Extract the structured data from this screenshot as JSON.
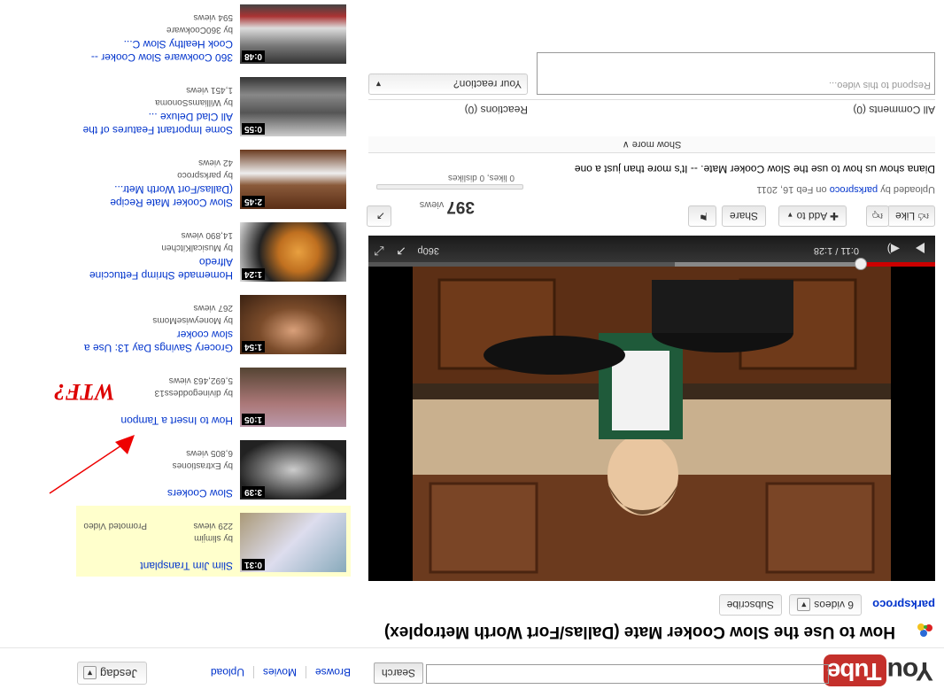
{
  "header": {
    "logo_you": "You",
    "logo_tube": "Tube",
    "search_value": "",
    "search_button": "Search",
    "nav": [
      "Browse",
      "Movies",
      "Upload"
    ],
    "user": "Jesdag"
  },
  "video": {
    "title": "How to Use the Slow Cooker Mate (Dallas/Fort Worth Metroplex)",
    "channel": "parksproco",
    "videos_count": "6 videos",
    "subscribe": "Subscribe",
    "time": "0:11 / 1:28",
    "quality": "360p",
    "progress_fraction": 0.13,
    "buffered_fraction": 0.46
  },
  "actions": {
    "like": "Like",
    "add_to": "Add to",
    "share": "Share",
    "views_count": "397",
    "views_label": "views",
    "likes_stats": "0 likes, 0 dislikes"
  },
  "info": {
    "uploaded_prefix": "Uploaded by",
    "uploader": "parksproco",
    "uploaded_date": "on Feb 16, 2011",
    "description": "Diana show us how to use the Slow Cooker Mate. -- It's more than just a one",
    "show_more": "Show more"
  },
  "comments": {
    "all_comments": "All Comments (0)",
    "reactions": "Reactions (0)",
    "placeholder": "Respond to this video...",
    "reaction_select": "Your reaction?"
  },
  "sidebar": [
    {
      "title": "360 Cookware Slow Cooker -- Cook Healthy Slow C...",
      "by": "by 360Cookware",
      "views": "594 views",
      "duration": "0:48",
      "promoted": ""
    },
    {
      "title": "Some Important Features of the All Clad Deluxe ...",
      "by": "by WilliamsSonoma",
      "views": "1,451 views",
      "duration": "0:55",
      "promoted": ""
    },
    {
      "title": "Slow Cooker Mate Recipe (Dallas/Fort Worth Metr...",
      "by": "by parksproco",
      "views": "42 views",
      "duration": "2:45",
      "promoted": ""
    },
    {
      "title": "Homemade Shrimp Fettuccine Alfredo",
      "by": "by MusicalKitchen",
      "views": "14,890 views",
      "duration": "1:24",
      "promoted": ""
    },
    {
      "title": "Grocery Savings Day 13: Use a slow cooker",
      "by": "by MoneywiseMoms",
      "views": "267 views",
      "duration": "1:54",
      "promoted": ""
    },
    {
      "title": "How to Insert a Tampon",
      "by": "by divinegoddess13",
      "views": "5,692,463 views",
      "duration": "1:05",
      "promoted": ""
    },
    {
      "title": "Slow Cookers",
      "by": "by Extrastiones",
      "views": "6,805 views",
      "duration": "3:39",
      "promoted": ""
    },
    {
      "title": "Slim Jim Transplant",
      "by": "by slimjim",
      "views": "229 views",
      "duration": "0:31",
      "promoted": "Promoted Video"
    }
  ],
  "annotation": "WTF?"
}
